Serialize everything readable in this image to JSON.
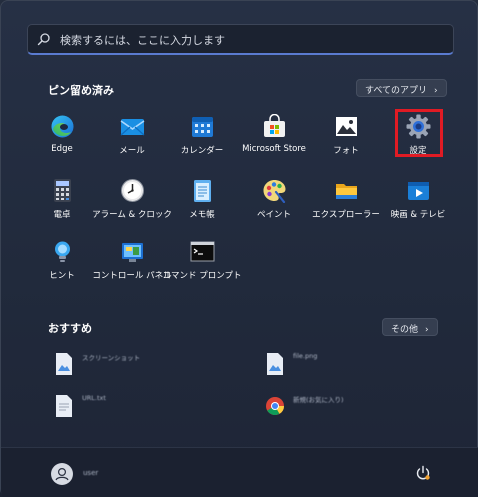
{
  "search": {
    "placeholder": "検索するには、ここに入力します",
    "icon": "search-icon"
  },
  "pinned": {
    "title": "ピン留め済み",
    "all_apps_label": "すべてのアプリ",
    "apps": [
      {
        "label": "Edge",
        "icon": "edge-icon"
      },
      {
        "label": "メール",
        "icon": "mail-icon"
      },
      {
        "label": "カレンダー",
        "icon": "calendar-icon"
      },
      {
        "label": "Microsoft Store",
        "icon": "store-icon"
      },
      {
        "label": "フォト",
        "icon": "photos-icon"
      },
      {
        "label": "設定",
        "icon": "settings-icon"
      },
      {
        "label": "電卓",
        "icon": "calculator-icon"
      },
      {
        "label": "アラーム & クロック",
        "icon": "alarm-clock-icon"
      },
      {
        "label": "メモ帳",
        "icon": "notepad-icon"
      },
      {
        "label": "ペイント",
        "icon": "paint-icon"
      },
      {
        "label": "エクスプローラー",
        "icon": "folder-icon"
      },
      {
        "label": "映画 & テレビ",
        "icon": "movies-tv-icon"
      },
      {
        "label": "ヒント",
        "icon": "tips-icon"
      },
      {
        "label": "コントロール パネル",
        "icon": "control-panel-icon"
      },
      {
        "label": "コマンド プロンプト",
        "icon": "command-prompt-icon"
      }
    ]
  },
  "recommended": {
    "title": "おすすめ",
    "more_label": "その他",
    "items": [
      {
        "name": "スクリーンショット",
        "time": ""
      },
      {
        "name": "file.png",
        "time": ""
      },
      {
        "name": "URL.txt",
        "time": ""
      },
      {
        "name": "新規(お気に入り)",
        "time": ""
      }
    ]
  },
  "user": {
    "name": "user"
  },
  "colors": {
    "highlight": "#e01b24",
    "accent": "#5a7bd0"
  }
}
